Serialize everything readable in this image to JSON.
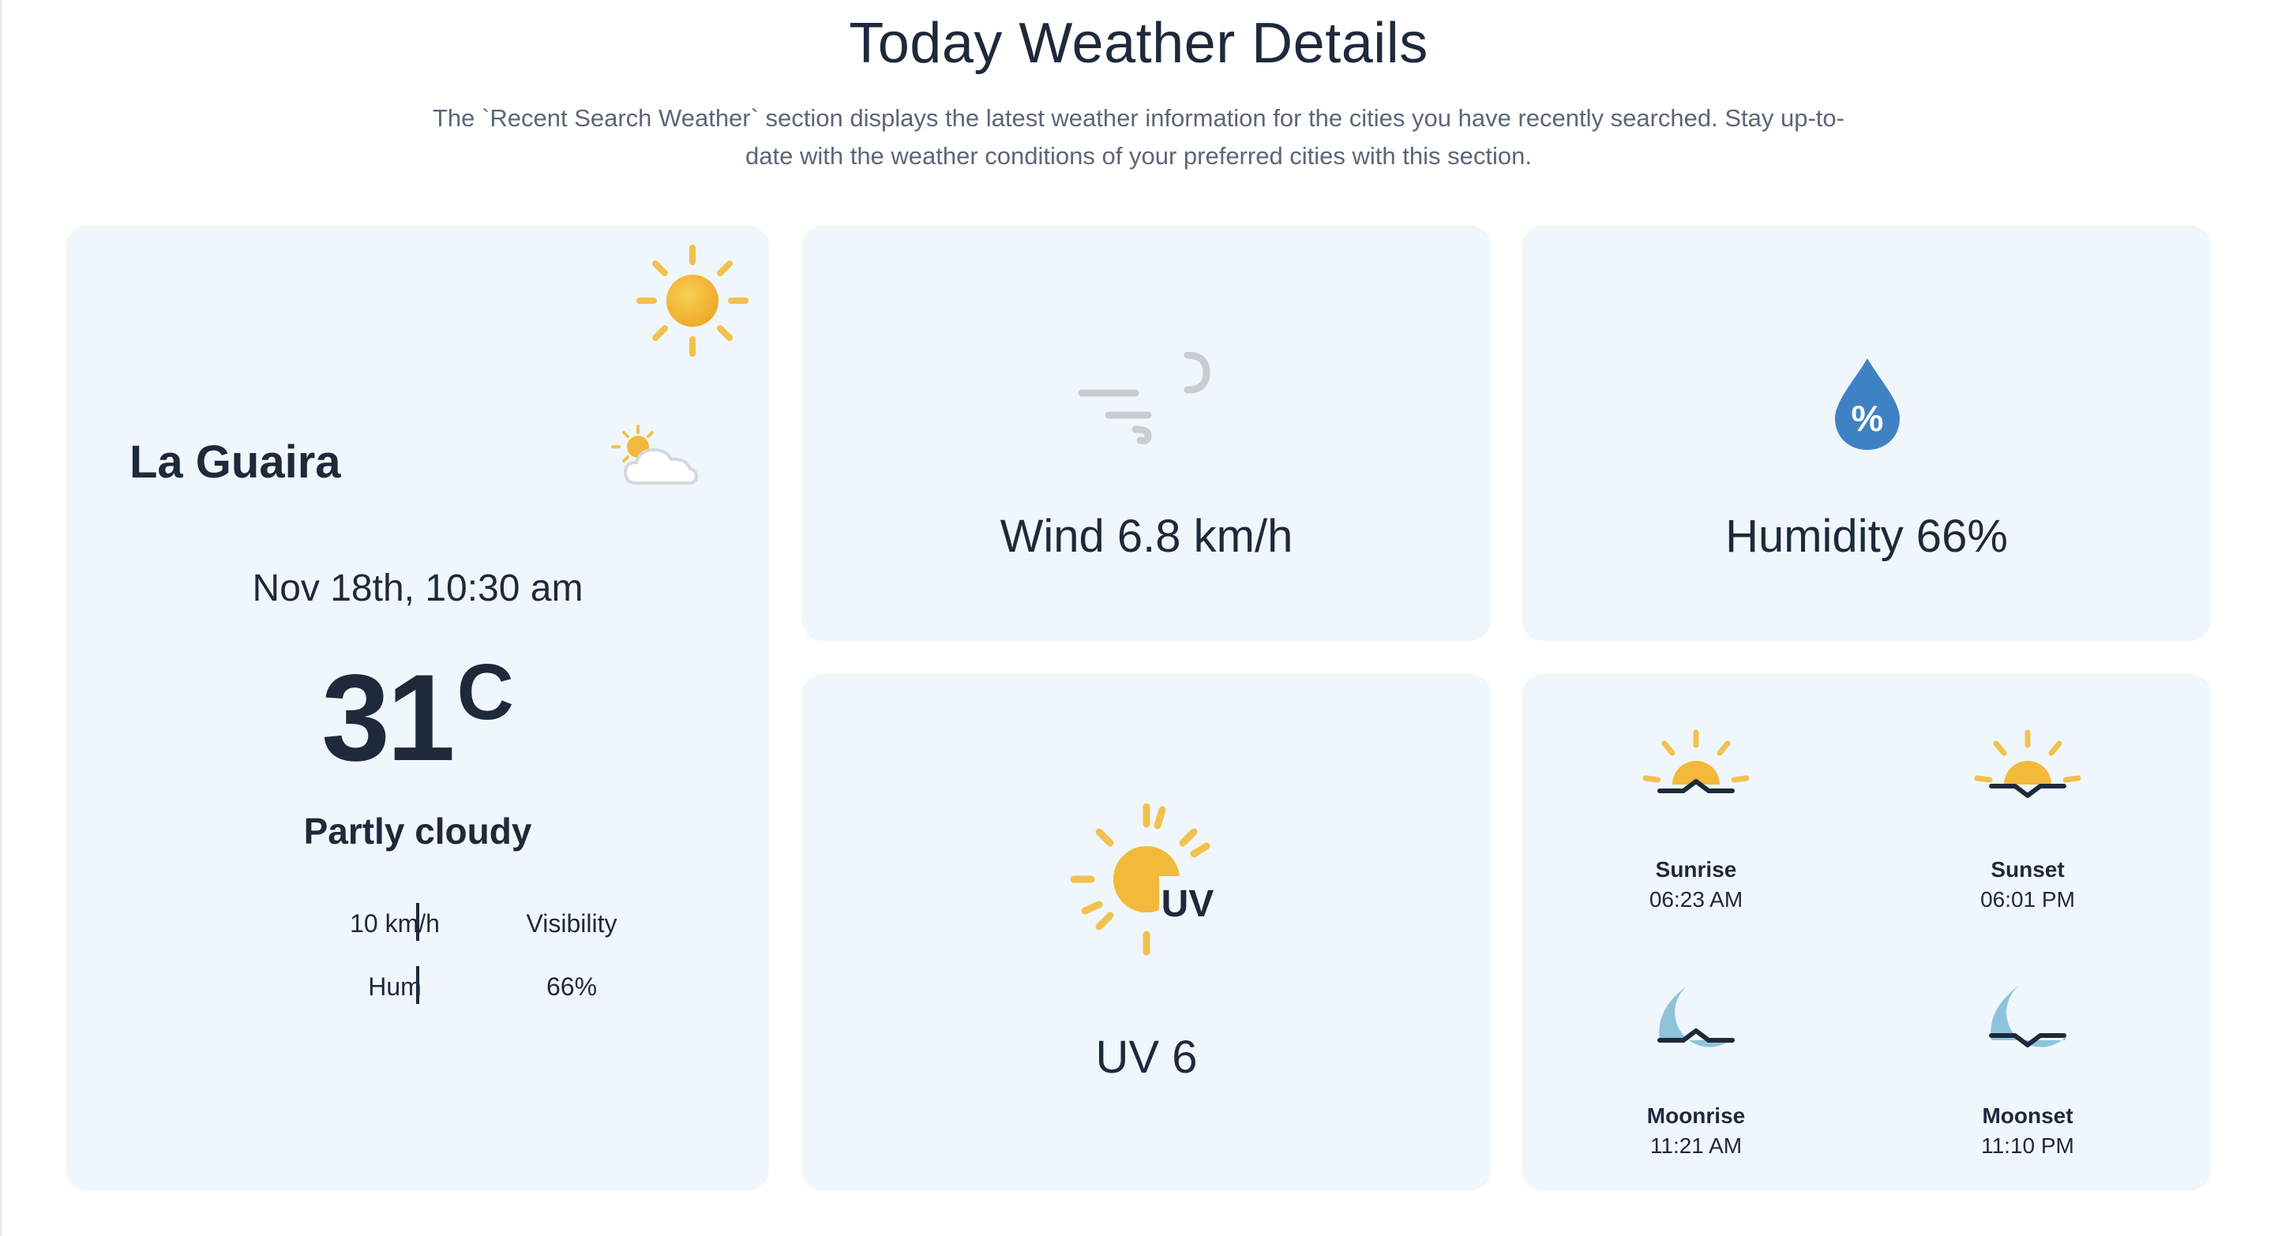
{
  "header": {
    "title": "Today Weather Details",
    "description": "The `Recent Search Weather` section displays the latest weather information for the cities you have recently searched. Stay up-to-date with the weather conditions of your preferred cities with this section."
  },
  "city_card": {
    "city": "La Guaira",
    "datetime": "Nov 18th, 10:30 am",
    "temperature": "31",
    "unit": "C",
    "condition": "Partly cloudy",
    "wind_value": "10 km/h",
    "visibility_label": "Visibility",
    "humidity_label": "Hum",
    "humidity_value": "66%",
    "icons": [
      "sun-icon",
      "partly-cloudy-icon"
    ]
  },
  "wind_card": {
    "label": "Wind 6.8 km/h",
    "icon": "wind-icon"
  },
  "humidity_card": {
    "label": "Humidity 66%",
    "icon": "humidity-drop-icon",
    "icon_symbol": "%"
  },
  "uv_card": {
    "label": "UV 6",
    "icon": "uv-icon",
    "icon_text": "UV"
  },
  "astro_card": {
    "items": [
      {
        "label": "Sunrise",
        "time": "06:23 AM",
        "icon": "sunrise-icon"
      },
      {
        "label": "Sunset",
        "time": "06:01 PM",
        "icon": "sunset-icon"
      },
      {
        "label": "Moonrise",
        "time": "11:21 AM",
        "icon": "moonrise-icon"
      },
      {
        "label": "Moonset",
        "time": "11:10 PM",
        "icon": "moonset-icon"
      }
    ]
  },
  "colors": {
    "card_bg": "#eff7fc",
    "sun": "#f3b93a",
    "sun_ray": "#f2c14e",
    "drop": "#3f82c4",
    "moon": "#8fc3dc",
    "text": "#1e293b",
    "muted": "#5b6678"
  }
}
